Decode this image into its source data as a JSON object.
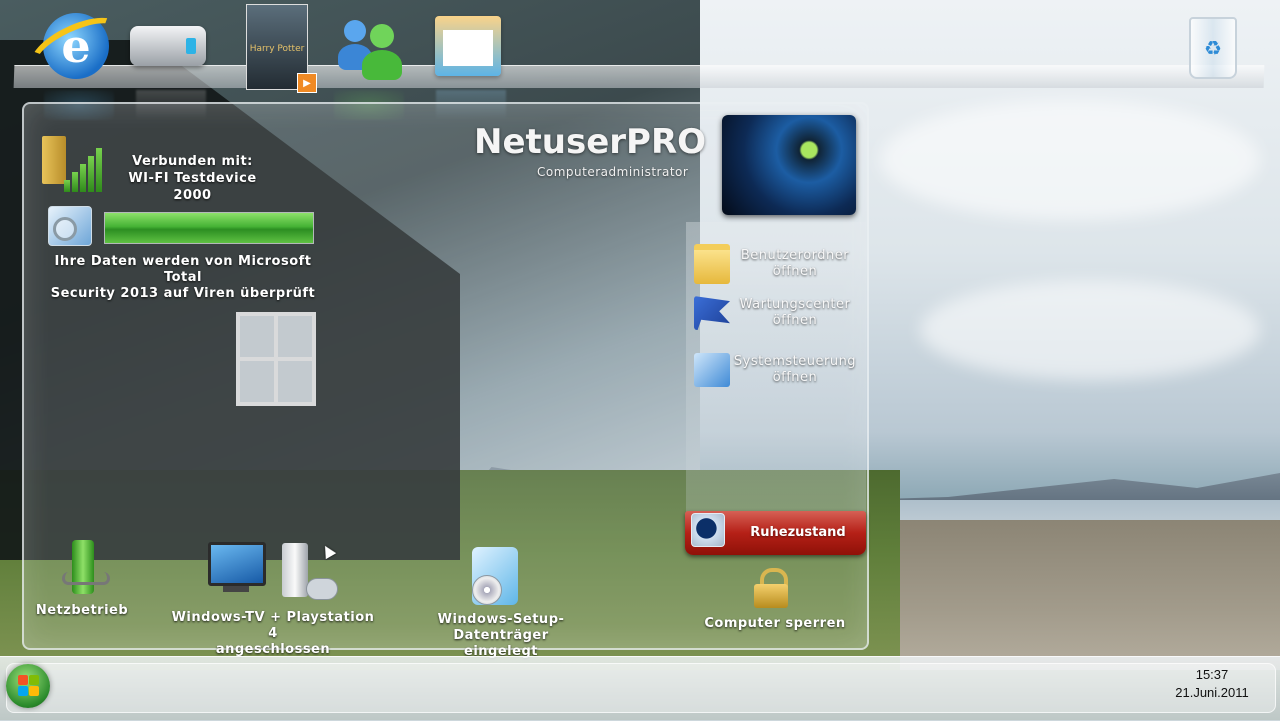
{
  "dock": {
    "items": [
      {
        "name": "internet-explorer",
        "icon": "internet-explorer-icon",
        "glyph": "e"
      },
      {
        "name": "drive",
        "icon": "hard-drive-icon"
      },
      {
        "name": "movie",
        "icon": "harry-potter-movie-icon",
        "caption": "Harry Potter"
      },
      {
        "name": "users",
        "icon": "users-icon"
      },
      {
        "name": "mail",
        "icon": "windows-live-mail-icon"
      }
    ],
    "trash_icon": "recycle-bin-icon"
  },
  "header": {
    "title": "NetuserPRO",
    "subtitle": "Computeradministrator"
  },
  "network": {
    "line1": "Verbunden mit:",
    "line2": "WI-FI Testdevice 2000"
  },
  "scan": {
    "progress": 1.0,
    "line1": "Ihre Daten werden von Microsoft Total",
    "line2": "Security 2013 auf Viren überprüft"
  },
  "links": [
    {
      "line1": "Benutzerordner",
      "line2": "öffnen",
      "icon": "folder-icon"
    },
    {
      "line1": "Wartungscenter",
      "line2": "öffnen",
      "icon": "action-center-flag-icon"
    },
    {
      "line1": "Systemsteuerung",
      "line2": "öffnen",
      "icon": "control-panel-icon"
    }
  ],
  "power": {
    "sleep_label": "Ruhezustand",
    "lock_label": "Computer sperren"
  },
  "status": {
    "power_label": "Netzbetrieb",
    "devices_line1": "Windows-TV + Playstation 4",
    "devices_line2": "angeschlossen",
    "setup_line1": "Windows-Setup-Datenträger",
    "setup_line2": "eingelegt"
  },
  "taskbar": {
    "time": "15:37",
    "date": "21.Juni.2011"
  },
  "colors": {
    "sleep_button": "#b52017",
    "progress_fill": "#46b335"
  }
}
